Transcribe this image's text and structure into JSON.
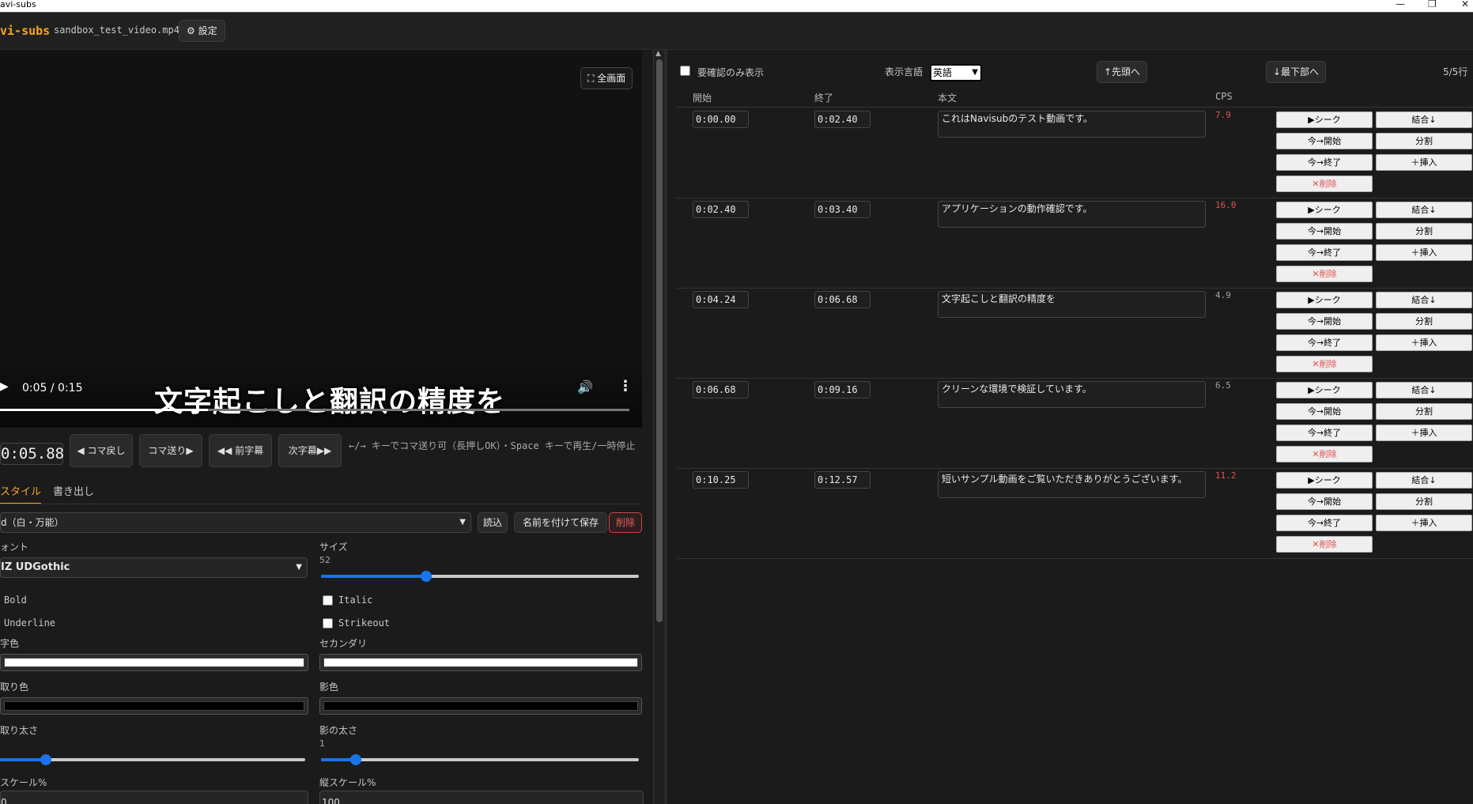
{
  "window": {
    "title": "avi-subs",
    "controls": [
      "—",
      "❐",
      "✕"
    ]
  },
  "app": {
    "logo": "vi-subs",
    "filename": "sandbox_test_video.mp4",
    "settings_label": "⚙ 設定"
  },
  "video": {
    "fullscreen_label": "⛶ 全画面",
    "play_glyph": "▶",
    "time_display": "0:05 / 0:15",
    "subtitle": "文字起こしと翻訳の精度を",
    "volume_glyph": "🔊",
    "more_glyph": "⋮",
    "progress": 0.33
  },
  "transport": {
    "timecode": "0:05.88",
    "buttons": [
      "◀ コマ戻し",
      "コマ送り▶",
      "◀◀ 前字幕",
      "次字幕▶▶"
    ],
    "hint": "←/→ キーでコマ送り可（長押しOK）・Space キーで再生/一時停止"
  },
  "tabs": {
    "style": "スタイル",
    "export": "書き出し"
  },
  "style_panel": {
    "preset": "d（白・万能）",
    "load_label": "読込",
    "save_as_label": "名前を付けて保存",
    "delete_label": "削除",
    "font_label": "ォント",
    "font_value": "IZ UDGothic",
    "size_label": "サイズ",
    "size_value": "52",
    "size_fraction": 0.33,
    "bold_label": "Bold",
    "italic_label": "Italic",
    "underline_label": "Underline",
    "strikeout_label": "Strikeout",
    "primary_color_label": "字色",
    "secondary_color_label": "セカンダリ",
    "outline_color_label": "取り色",
    "shadow_color_label": "影色",
    "primary_color": "#ffffff",
    "secondary_color": "#ffffff",
    "outline_color": "#000000",
    "shadow_color": "#000000",
    "outline_width_label": "取り太さ",
    "outline_fraction": 0.15,
    "shadow_width_label": "影の太さ",
    "shadow_width_value": "1",
    "shadow_fraction": 0.11,
    "scale_x_label": "スケール%",
    "scale_x_value": "0",
    "scale_y_label": "縦スケール%",
    "scale_y_value": "100"
  },
  "subtitles_panel": {
    "review_only_label": "要確認のみ表示",
    "display_lang_label": "表示言語",
    "display_lang_value": "英語",
    "to_top_label": "↑先頭へ",
    "to_bottom_label": "↓最下部へ",
    "row_count": "5/5行",
    "columns": {
      "start": "開始",
      "end": "終了",
      "text": "本文",
      "cps": "CPS"
    },
    "action_labels": {
      "seek": "▶シーク",
      "merge": "結合↓",
      "now_start": "今→開始",
      "split": "分割",
      "now_end": "今→終了",
      "insert": "＋挿入",
      "delete": "✕削除"
    },
    "rows": [
      {
        "start": "0:00.00",
        "end": "0:02.40",
        "text": "これはNavisubのテスト動画です。",
        "cps": "7.9",
        "cps_color": "#e05050"
      },
      {
        "start": "0:02.40",
        "end": "0:03.40",
        "text": "アプリケーションの動作確認です。",
        "cps": "16.0",
        "cps_color": "#e05050"
      },
      {
        "start": "0:04.24",
        "end": "0:06.68",
        "text": "文字起こしと翻訳の精度を",
        "cps": "4.9",
        "cps_color": "#a0a0a0"
      },
      {
        "start": "0:06.68",
        "end": "0:09.16",
        "text": "クリーンな環境で検証しています。",
        "cps": "6.5",
        "cps_color": "#a0a0a0"
      },
      {
        "start": "0:10.25",
        "end": "0:12.57",
        "text": "短いサンプル動画をご覧いただきありがとうございます。",
        "cps": "11.2",
        "cps_color": "#e05050"
      }
    ]
  }
}
